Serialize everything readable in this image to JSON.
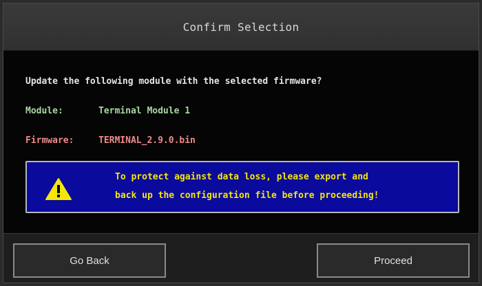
{
  "dialog": {
    "title": "Confirm Selection",
    "question": "Update the following module with the selected firmware?",
    "module_label": "Module:",
    "module_value": "Terminal Module 1",
    "firmware_label": "Firmware:",
    "firmware_value": "TERMINAL_2.9.0.bin",
    "warning": {
      "icon": "warning-triangle-icon",
      "line1": "To protect against data loss, please export and",
      "line2": "back up the configuration file before proceeding!"
    }
  },
  "buttons": {
    "back_label": "Go Back",
    "proceed_label": "Proceed"
  },
  "colors": {
    "module_text": "#a8d8a0",
    "firmware_text": "#f08a8a",
    "warning_bg": "#0a0a9c",
    "warning_text": "#f5e60a"
  }
}
